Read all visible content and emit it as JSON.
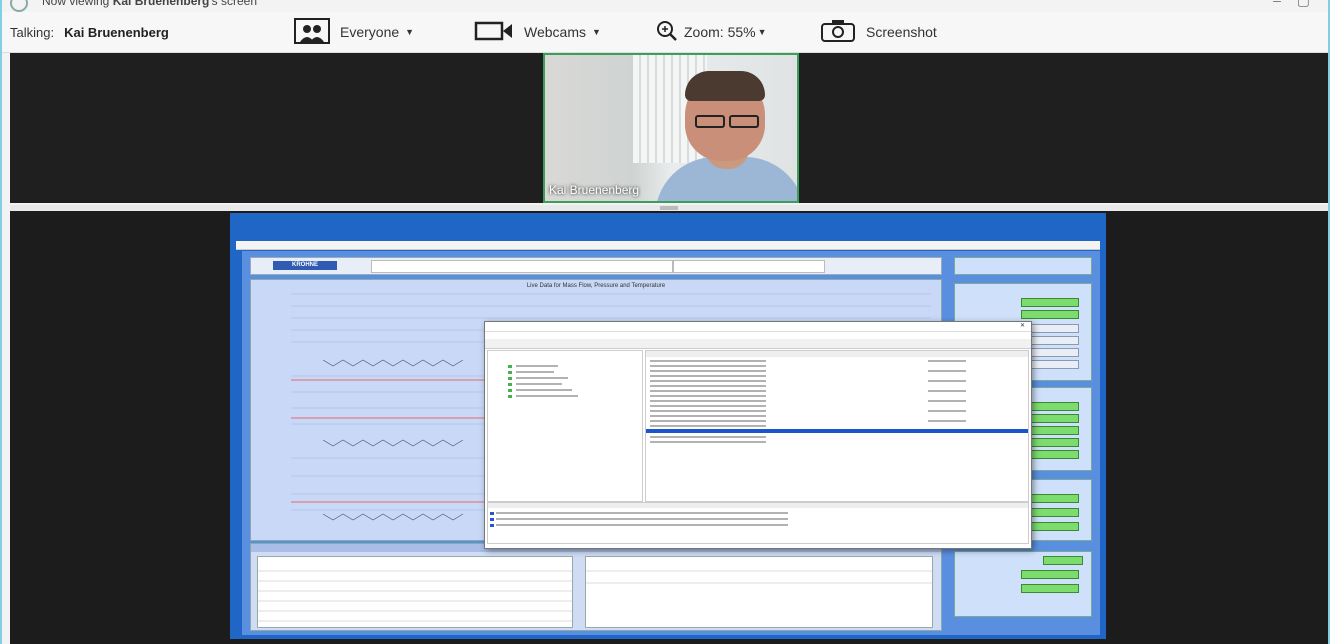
{
  "window": {
    "title_prefix": "Now viewing",
    "title_name": "Kai Bruenenberg",
    "title_suffix": "'s screen"
  },
  "toolbar": {
    "talking_label": "Talking:",
    "talking_name": "Kai Bruenenberg",
    "everyone_label": "Everyone",
    "webcams_label": "Webcams",
    "zoom_label": "Zoom: 55%",
    "screenshot_label": "Screenshot"
  },
  "webcam": {
    "participant_name": "Kai Bruenenberg"
  },
  "shared_screen": {
    "brand": "KROHNE",
    "plot_title": "Live Data for Mass Flow, Pressure and Temperature"
  },
  "colors": {
    "accent_green": "#3b9e5a",
    "screen_blue": "#1f66c7",
    "dark_bg": "#1c1c1c"
  }
}
